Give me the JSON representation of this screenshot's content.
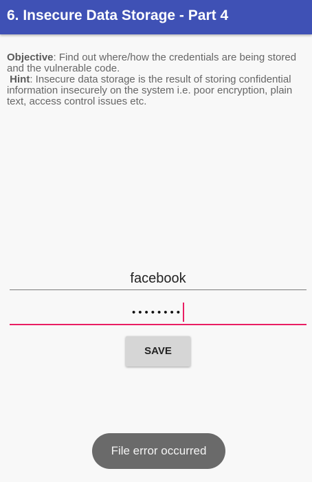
{
  "app_bar": {
    "title": "6. Insecure Data Storage - Part 4",
    "color": "#3f51b5"
  },
  "description": {
    "objective_label": "Objective",
    "objective_text": ": Find out where/how the credentials are being stored and the vulnerable code.",
    "hint_label": "Hint",
    "hint_text": ": Insecure data storage is the result of storing confidential information insecurely on the system i.e. poor encryption, plain text, access control issues etc."
  },
  "form": {
    "username_value": "facebook",
    "password_value": "••••••••",
    "save_label": "SAVE",
    "accent_color": "#e91e63"
  },
  "toast": {
    "message": "File error occurred"
  }
}
